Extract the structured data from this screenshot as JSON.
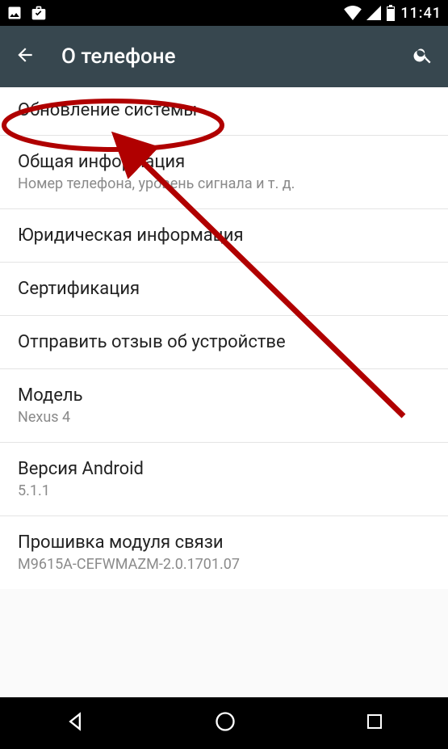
{
  "status": {
    "time": "11:41"
  },
  "header": {
    "title": "О телефоне"
  },
  "items": [
    {
      "title": "Обновление системы"
    },
    {
      "title": "Общая информация",
      "sub": "Номер телефона, уровень сигнала и т. д."
    },
    {
      "title": "Юридическая информация"
    },
    {
      "title": "Сертификация"
    },
    {
      "title": "Отправить отзыв об устройстве"
    },
    {
      "title": "Модель",
      "sub": "Nexus 4"
    },
    {
      "title": "Версия Android",
      "sub": "5.1.1"
    },
    {
      "title": "Прошивка модуля связи",
      "sub": "M9615A-CEFWMAZM-2.0.1701.07"
    }
  ]
}
